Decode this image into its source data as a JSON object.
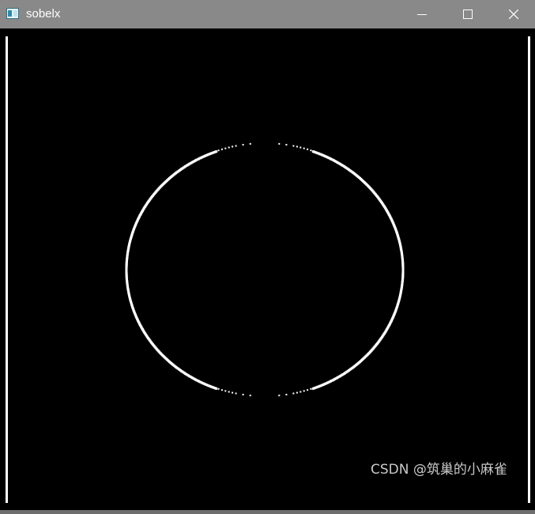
{
  "window": {
    "title": "sobelx",
    "app_icon": "opencv-window-icon",
    "controls": {
      "minimize_icon": "minimize-icon",
      "maximize_icon": "maximize-icon",
      "close_icon": "close-icon"
    },
    "colors": {
      "titlebar": "#898989",
      "canvas_background": "#000000",
      "edge_pixels": "#ffffff"
    }
  },
  "image": {
    "content": "Sobel x-gradient edge result: white elliptical outline with gaps at top and bottom, vertical white edge lines on left and right borders"
  },
  "watermark": {
    "text": "CSDN @筑巢的小麻雀"
  }
}
